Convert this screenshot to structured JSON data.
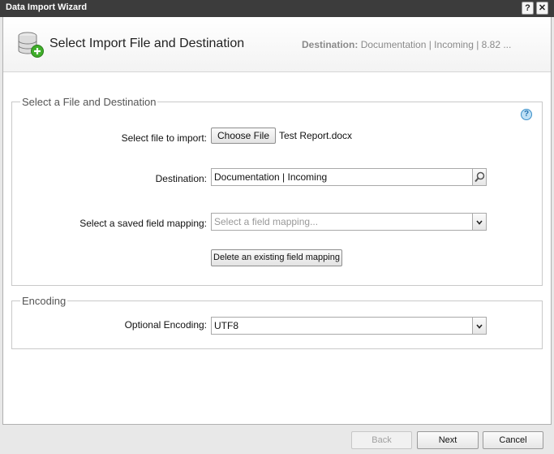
{
  "window": {
    "title": "Data Import Wizard",
    "help_glyph": "?",
    "close_glyph": "✕"
  },
  "header": {
    "title": "Select Import File and Destination",
    "destination_label": "Destination:",
    "destination_value": "Documentation | Incoming | 8.82 ...",
    "icon": "database-add-icon"
  },
  "file_section": {
    "legend": "Select a File and Destination",
    "help_glyph": "?",
    "file_label": "Select file to import:",
    "choose_file_label": "Choose File",
    "file_name": "Test Report.docx",
    "destination_label": "Destination:",
    "destination_value": "Documentation | Incoming",
    "mapping_label": "Select a saved field mapping:",
    "mapping_placeholder": "Select a field mapping...",
    "delete_mapping_label": "Delete an existing field mapping"
  },
  "encoding_section": {
    "legend": "Encoding",
    "encoding_label": "Optional Encoding:",
    "encoding_value": "UTF8"
  },
  "footer": {
    "back_label": "Back",
    "next_label": "Next",
    "cancel_label": "Cancel"
  },
  "colors": {
    "titlebar": "#3c3c3c",
    "accent_green": "#3fae2a",
    "help_blue": "#3a8fc9"
  }
}
